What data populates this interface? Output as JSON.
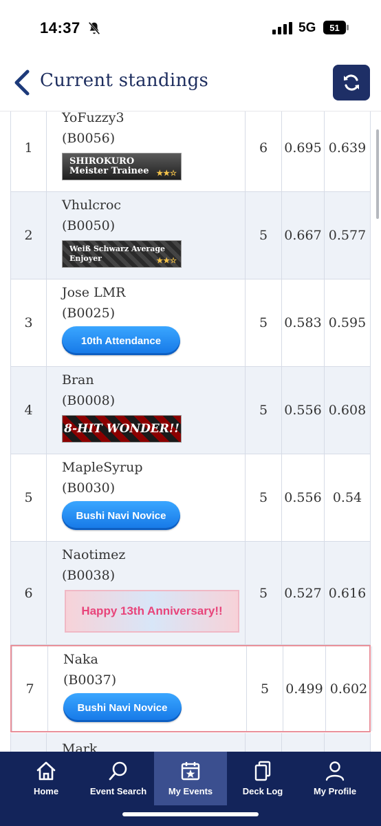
{
  "status": {
    "time": "14:37",
    "network": "5G",
    "battery": "51"
  },
  "header": {
    "title": "Current standings"
  },
  "rows": [
    {
      "rank": "1",
      "name": "YoFuzzy3",
      "id": "(B0056)",
      "badge": "SHIROKURO Meister Trainee",
      "badge_type": "banner-dark",
      "points": "6",
      "omw": "0.695",
      "gw": "0.639"
    },
    {
      "rank": "2",
      "name": "Vhulcroc",
      "id": "(B0050)",
      "badge": "Weiß Schwarz Average Enjoyer",
      "badge_type": "banner-checker",
      "points": "5",
      "omw": "0.667",
      "gw": "0.577"
    },
    {
      "rank": "3",
      "name": "Jose LMR",
      "id": "(B0025)",
      "badge": "10th Attendance",
      "badge_type": "pill",
      "points": "5",
      "omw": "0.583",
      "gw": "0.595"
    },
    {
      "rank": "4",
      "name": "Bran",
      "id": "(B0008)",
      "badge": "8-HIT WONDER!!",
      "badge_type": "banner-red",
      "points": "5",
      "omw": "0.556",
      "gw": "0.608"
    },
    {
      "rank": "5",
      "name": "MapleSyrup",
      "id": "(B0030)",
      "badge": "Bushi Navi Novice",
      "badge_type": "pill",
      "points": "5",
      "omw": "0.556",
      "gw": "0.54"
    },
    {
      "rank": "6",
      "name": "Naotimez",
      "id": "(B0038)",
      "badge": "Happy 13th Anniversary!!",
      "badge_type": "banner-anniv",
      "points": "5",
      "omw": "0.527",
      "gw": "0.616"
    },
    {
      "rank": "7",
      "name": "Naka",
      "id": "(B0037)",
      "badge": "Bushi Navi Novice",
      "badge_type": "pill",
      "points": "5",
      "omw": "0.499",
      "gw": "0.602"
    },
    {
      "rank": "",
      "name": "Mark",
      "id": "",
      "badge": "",
      "badge_type": "",
      "points": "",
      "omw": "",
      "gw": ""
    }
  ],
  "nav": [
    {
      "label": "Home",
      "icon": "home-icon"
    },
    {
      "label": "Event Search",
      "icon": "search-icon"
    },
    {
      "label": "My Events",
      "icon": "calendar-star-icon"
    },
    {
      "label": "Deck Log",
      "icon": "deck-icon"
    },
    {
      "label": "My Profile",
      "icon": "profile-icon"
    }
  ],
  "colors": {
    "navy": "#13245a",
    "title": "#1d2d5e",
    "row_alt": "#eef2f8",
    "highlight": "#e9909a",
    "pill": "#1577e6"
  }
}
